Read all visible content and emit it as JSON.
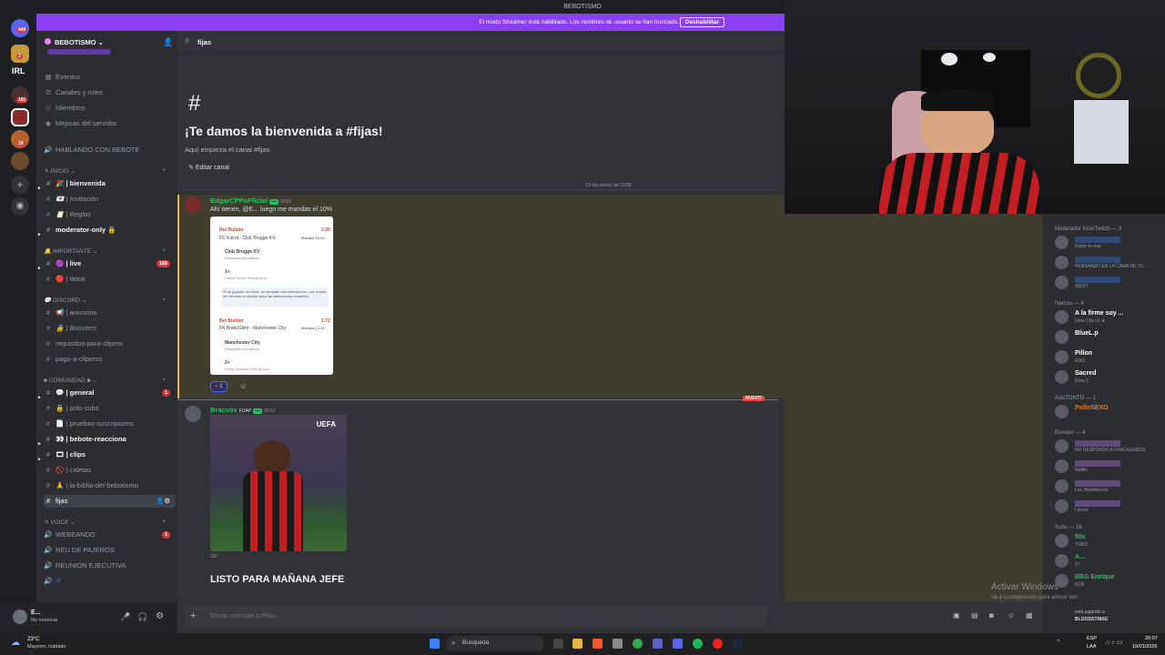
{
  "window": {
    "title": "BEBOTISMO"
  },
  "guild_rail": {
    "home_badge": "449",
    "irl_label": "IRL",
    "badge_2": "2",
    "badge_191": "191",
    "badge_28": "28"
  },
  "streamer_banner": {
    "text": "El modo Streamer está habilitado. Los nombres de usuario se han truncado.",
    "button": "Deshabilitar"
  },
  "server": {
    "name": "BEBOTISMO",
    "top_items": [
      "Eventos",
      "Canales y roles",
      "Miembros",
      "Mejoras del servidor"
    ],
    "special_item": "HABLANDO CON BEBOTE",
    "categories": {
      "inicio": "INICIO",
      "importante": "IMPORTANTE",
      "discord": "DISCORD",
      "comunidad": "COMUNIDAD",
      "voice": "VOICE"
    },
    "channels": {
      "bienvenida": "| bienvenida",
      "invitacion": "| Invitación",
      "reglas": "| Reglas",
      "moderator": "moderator-only",
      "live": "| live",
      "live_badge": "189",
      "tiktok": "| tiktok",
      "anuncios": "| anuncios",
      "boosters": "| Boosters",
      "requisitos": "requisitos-para-clipero",
      "pago": "pago-a-cliperos",
      "general": "| general",
      "general_badge": "1",
      "solo_subs": "| solo-subs",
      "pruebas": "| pruebas-suscriptores",
      "reaccion": "| bebote-reacciona",
      "clips": "| clips",
      "caletas": "| caletas",
      "biblia": "| la-biblia-del-bebotismo",
      "fijas": "fijas",
      "webeando": "WEBEANDO",
      "webeando_badge": "1",
      "reu": "REU DE PAJEROS",
      "reunion": "REUNION EJECUTIVA"
    }
  },
  "user_panel": {
    "name": "E...",
    "status": "No molestar"
  },
  "channel_header": {
    "name": "fijas"
  },
  "welcome": {
    "title": "¡Te damos la bienvenida a #fijas!",
    "subtitle": "Aquí empieza el canal #fijas.",
    "edit": "Editar canal"
  },
  "date_divider": "19 de enero de 2026",
  "message1": {
    "author": "EdgarCPPoFficial",
    "time": "19:01",
    "text": "Ahí tienen, @E... luego me mandas el 10%",
    "reaction_count": "1",
    "card": {
      "bb1": "Bet Builder",
      "odd1": "3.30",
      "match1": "FC Kairat - Club Brugge KV",
      "when1": "Mañana 10:30",
      "pick1": "Club Brugge KV",
      "pick1_sub": "Resultado del partido",
      "pick2": "1+",
      "pick2_sub": "Carlos Forbs Tiros al Arco",
      "note": "Si un jugador no inicia, se anularán sus selecciones. Las cuotas se volverán a calcular para las selecciones restantes.",
      "bb2": "Bet Builder",
      "odd2": "1.72",
      "match2": "FK Bodo/Glimt - Manchester City",
      "when2": "Mañana 12:45",
      "pick3": "Manchester City",
      "pick3_sub": "Resultado del partido",
      "pick4": "2+",
      "pick4_sub": "Erling Haaland Tiros al Arco"
    }
  },
  "new_label": "NUEVO",
  "message2": {
    "author": "Bracsóx",
    "tag": "FUAP",
    "time": "20:07",
    "gif_overlay": "UEFA",
    "gif_label": "GIF",
    "text": "LISTO PARA MAÑANA JEFE"
  },
  "chat_input": {
    "placeholder": "Enviar mensaje a #fijas"
  },
  "members": {
    "groups": [
      {
        "label": "Moderador Kick/Twitch — 3",
        "members": [
          {
            "name": "",
            "status": "Kickd no exe",
            "color": "#3b82f6"
          },
          {
            "name": "",
            "status": "PENSANDO EN LA CAMA DE TU ...",
            "color": "#3b82f6"
          },
          {
            "name": "",
            "status": "WEST",
            "color": "#3b82f6"
          }
        ]
      },
      {
        "label": "Narcos — 4",
        "members": [
          {
            "name": "A la firme soy ...",
            "status": "Lima City v1 ★",
            "color": "#ffffff"
          },
          {
            "name": "BlueL.p",
            "status": "",
            "color": "#ffffff"
          },
          {
            "name": "Pillon",
            "status": "EGO",
            "color": "#ffffff"
          },
          {
            "name": "Sacred",
            "status": "Dota 2",
            "color": "#ffffff"
          }
        ]
      },
      {
        "label": "AsisTONTO — 1",
        "members": [
          {
            "name": "PolloSEXO",
            "status": "",
            "color": "#f97316"
          }
        ]
      },
      {
        "label": "Booster — 4",
        "members": [
          {
            "name": "",
            "status": "NO RESPONDO A FRACASADOS",
            "color": "#c084fc"
          },
          {
            "name": "",
            "status": "Netflix",
            "color": "#c084fc"
          },
          {
            "name": "",
            "status": "Los Weebiturros",
            "color": "#c084fc"
          },
          {
            "name": "",
            "status": "I know",
            "color": "#c084fc"
          }
        ]
      },
      {
        "label": "Subs — 18",
        "members": [
          {
            "name": "50s",
            "status": "TORO",
            "color": "#22c55e"
          },
          {
            "name": "A...",
            "status": "27",
            "color": "#22c55e"
          },
          {
            "name": "BBG Enrique",
            "status": "FCB",
            "color": "#22c55e"
          }
        ]
      }
    ],
    "activity": {
      "playing": "está jugando a",
      "game": "BLOODSTRIKE"
    }
  },
  "activate_windows": {
    "line1": "Activar Windows",
    "line2": "Ve a Configuración para activar Windows."
  },
  "taskbar": {
    "weather_temp": "23°C",
    "weather_desc": "Mayorm. nublado",
    "search": "Búsqueda",
    "lang1": "ESP",
    "lang2": "LAA",
    "time": "20:07",
    "date": "19/01/2026"
  }
}
